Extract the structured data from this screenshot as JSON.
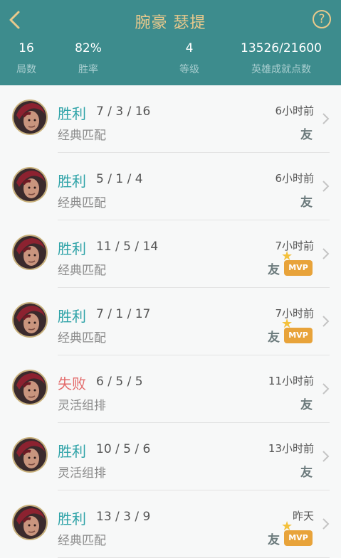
{
  "header": {
    "title": "腕豪 瑟提",
    "help_label": "?",
    "stats": [
      {
        "value": "16",
        "label": "局数"
      },
      {
        "value": "82%",
        "label": "胜率"
      },
      {
        "value": "4",
        "label": "等级"
      },
      {
        "value": "13526/21600",
        "label": "英雄成就点数"
      }
    ]
  },
  "matches": [
    {
      "result": "胜利",
      "kda": "7 / 3 / 16",
      "mode": "经典匹配",
      "time": "6小时前",
      "friend": "友",
      "mvp": ""
    },
    {
      "result": "胜利",
      "kda": "5 / 1 / 4",
      "mode": "经典匹配",
      "time": "6小时前",
      "friend": "友",
      "mvp": ""
    },
    {
      "result": "胜利",
      "kda": "11 / 5 / 14",
      "mode": "经典匹配",
      "time": "7小时前",
      "friend": "友",
      "mvp": "MVP"
    },
    {
      "result": "胜利",
      "kda": "7 / 1 / 17",
      "mode": "经典匹配",
      "time": "7小时前",
      "friend": "友",
      "mvp": "MVP"
    },
    {
      "result": "失败",
      "kda": "6 / 5 / 5",
      "mode": "灵活组排",
      "time": "11小时前",
      "friend": "友",
      "mvp": ""
    },
    {
      "result": "胜利",
      "kda": "10 / 5 / 6",
      "mode": "灵活组排",
      "time": "13小时前",
      "friend": "友",
      "mvp": ""
    },
    {
      "result": "胜利",
      "kda": "13 / 3 / 9",
      "mode": "经典匹配",
      "time": "昨天",
      "friend": "友",
      "mvp": "MVP"
    }
  ],
  "colors": {
    "header_bg": "#3d8c8d",
    "gold": "#e9c98c",
    "win": "#2fa3a8",
    "lose": "#e36a6a"
  }
}
